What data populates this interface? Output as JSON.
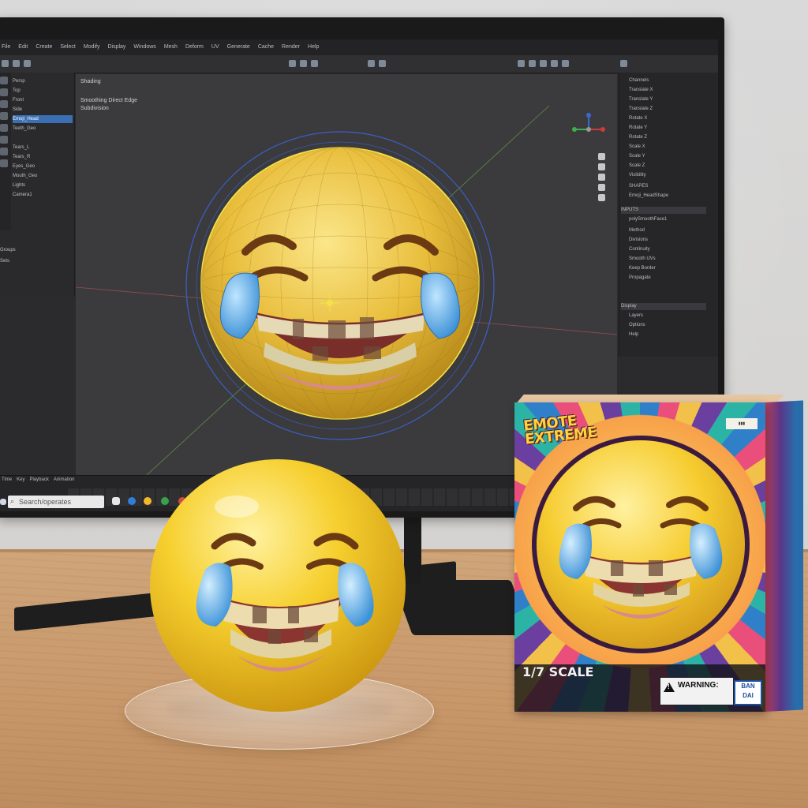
{
  "app": {
    "menu": [
      "File",
      "Edit",
      "Create",
      "Select",
      "Modify",
      "Display",
      "Windows",
      "Mesh",
      "Deform",
      "UV",
      "Generate",
      "Cache",
      "Render",
      "Help"
    ],
    "outliner": {
      "items": [
        "Persp",
        "Top",
        "Front",
        "Side",
        "Emoji_Head",
        "Teeth_Geo",
        "Tears_L",
        "Tears_R",
        "Eyes_Geo",
        "Mouth_Geo",
        "Lights",
        "Camera1",
        "Groups",
        "Sets"
      ]
    },
    "viewport": {
      "header": "Shading",
      "overlay_line1": "Smoothing Direct Edge",
      "overlay_line2": "Subdivision"
    },
    "attributes": {
      "rows": [
        "Channels",
        "Translate X",
        "Translate Y",
        "Translate Z",
        "Rotate X",
        "Rotate Y",
        "Rotate Z",
        "Scale X",
        "Scale Y",
        "Scale Z",
        "Visibility",
        "SHAPES",
        "Emoji_HeadShape",
        "INPUTS",
        "polySmoothFace1",
        "Method",
        "Divisions",
        "Continuity",
        "Smooth UVs",
        "Keep Border",
        "Propagate",
        "Display",
        "Layers",
        "Options",
        "Help"
      ]
    },
    "timeline": {
      "labels": [
        "Time",
        "Key",
        "Playback",
        "Animation"
      ]
    },
    "taskbar": {
      "search_placeholder": "Search/operates"
    }
  },
  "box": {
    "brand_line1": "EMOTE",
    "brand_line2": "EXTREME",
    "scale": "1/7 SCALE",
    "warning": "WARNING:",
    "maker": "BAN DAI"
  },
  "colors": {
    "emoji_yellow": "#f4c534",
    "tear_blue": "#5aaee8",
    "gum_pink": "#d98a86",
    "wire_blue": "#3b5fc9",
    "selection_yellow": "#f3e14a"
  },
  "icons": [
    "windows-logo-icon",
    "search-icon",
    "axis-gizmo-icon",
    "warning-icon"
  ]
}
